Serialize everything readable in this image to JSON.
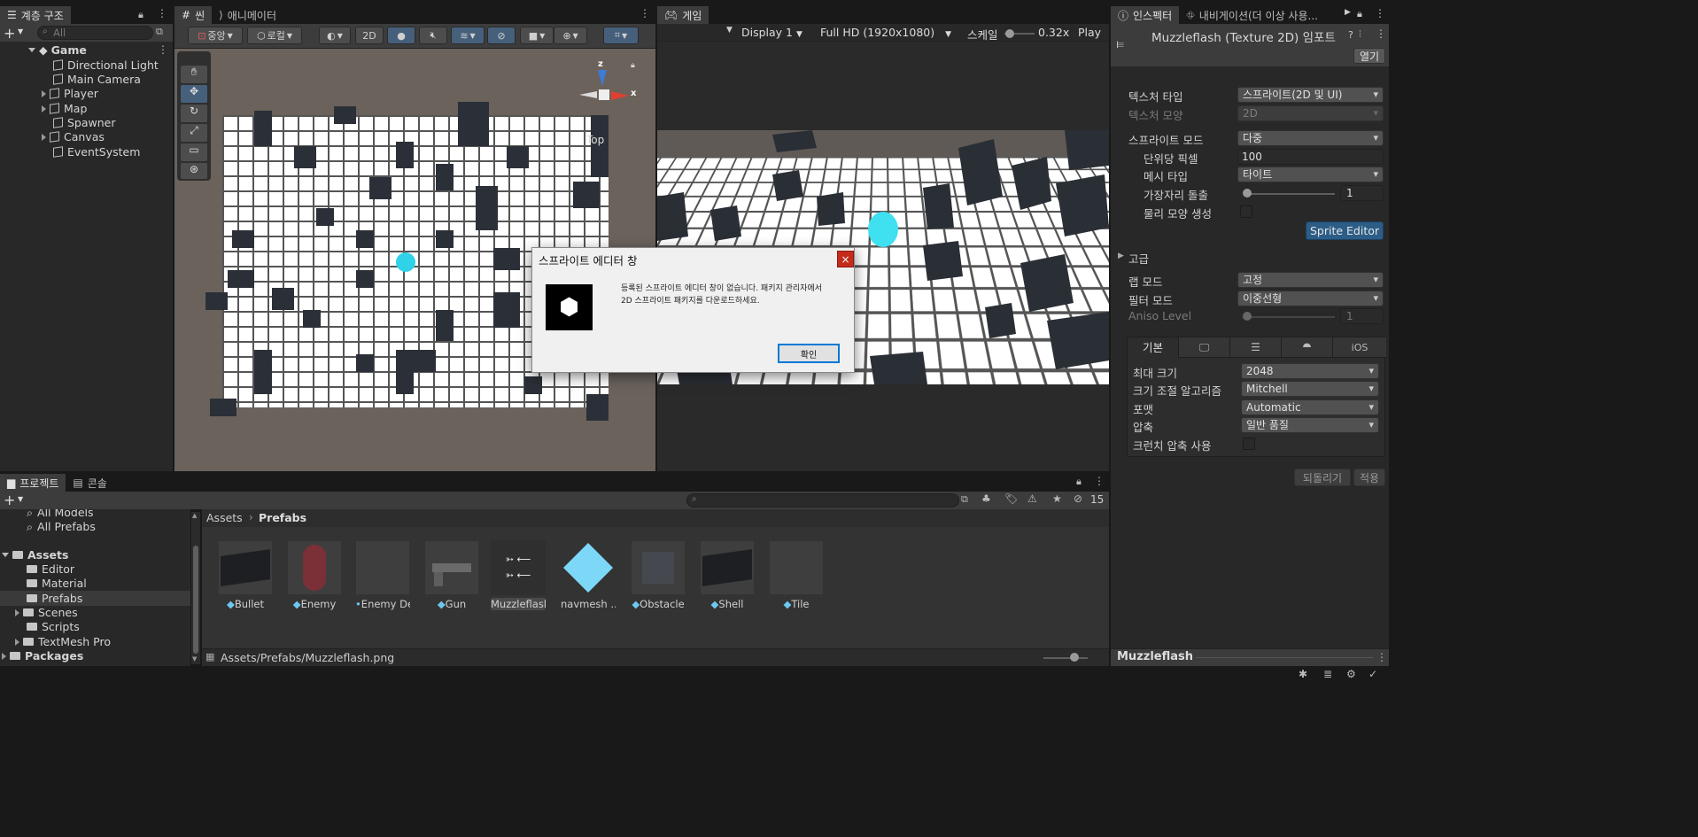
{
  "hierarchy": {
    "tab": "계층 구조",
    "search_placeholder": "All",
    "root": "Game",
    "items": [
      "Directional Light",
      "Main Camera",
      "Player",
      "Map",
      "Spawner",
      "Canvas",
      "EventSystem"
    ]
  },
  "scene": {
    "tab_scene": "씬",
    "tab_animator": "애니메이터",
    "pivot": "중앙",
    "space": "로컬",
    "mode_2d": "2D",
    "gizmo_top": "Top",
    "axis_x": "x",
    "axis_z": "z"
  },
  "game": {
    "tab": "게임",
    "display": "Display 1",
    "resolution": "Full HD (1920x1080)",
    "scale_label": "스케일",
    "scale_value": "0.32x",
    "play_focus": "Play F"
  },
  "dialog": {
    "title": "스프라이트 에디터 창",
    "message_line1": "등록된 스프라이트 에디터 창이 없습니다. 패키지 관리자에서",
    "message_line2": "2D 스프라이트 패키지를 다운로드하세요.",
    "ok": "확인",
    "close": "×"
  },
  "inspector": {
    "tab_inspector": "인스펙터",
    "tab_navigation": "내비게이션(더 이상 사용...",
    "asset_title": "Muzzleflash (Texture 2D) 임포트",
    "open_button": "열기",
    "texture_type_label": "텍스처 타입",
    "texture_type_value": "스프라이트(2D 및 UI)",
    "texture_shape_label": "텍스처 모양",
    "texture_shape_value": "2D",
    "sprite_mode_label": "스프라이트 모드",
    "sprite_mode_value": "다중",
    "ppu_label": "단위당 픽셀",
    "ppu_value": "100",
    "mesh_type_label": "메시 타입",
    "mesh_type_value": "타이트",
    "extrude_label": "가장자리 돌출",
    "extrude_value": "1",
    "physics_shape_label": "물리 모양 생성",
    "sprite_editor_button": "Sprite Editor",
    "advanced_label": "고급",
    "wrap_mode_label": "랩 모드",
    "wrap_mode_value": "고정",
    "filter_mode_label": "필터 모드",
    "filter_mode_value": "이중선형",
    "aniso_label": "Aniso Level",
    "aniso_value": "1",
    "platform_default": "기본",
    "platform_ios": "iOS",
    "max_size_label": "최대 크기",
    "max_size_value": "2048",
    "resize_label": "크기 조절 알고리즘",
    "resize_value": "Mitchell",
    "format_label": "포맷",
    "format_value": "Automatic",
    "compression_label": "압축",
    "compression_value": "일반 품질",
    "crunch_label": "크런치 압축 사용",
    "revert_button": "되돌리기",
    "apply_button": "적용",
    "preview_name": "Muzzleflash"
  },
  "project": {
    "tab_project": "프로젝트",
    "tab_console": "콘솔",
    "hidden_count": "15",
    "tree": {
      "all_models": "All Models",
      "all_prefabs": "All Prefabs",
      "assets": "Assets",
      "folders": [
        "Editor",
        "Material",
        "Prefabs",
        "Scenes",
        "Scripts",
        "TextMesh Pro"
      ],
      "packages": "Packages"
    },
    "breadcrumb_root": "Assets",
    "breadcrumb_current": "Prefabs",
    "assets": [
      "Bullet",
      "Enemy",
      "Enemy De...",
      "Gun",
      "Muzzleflash",
      "navmesh ...",
      "Obstacle",
      "Shell",
      "Tile"
    ],
    "selected_path": "Assets/Prefabs/Muzzleflash.png"
  },
  "colors": {
    "accent": "#46607c",
    "selection": "#2c5d87",
    "dialog_bg": "#f0f0f0",
    "close_red": "#c42b1c"
  }
}
